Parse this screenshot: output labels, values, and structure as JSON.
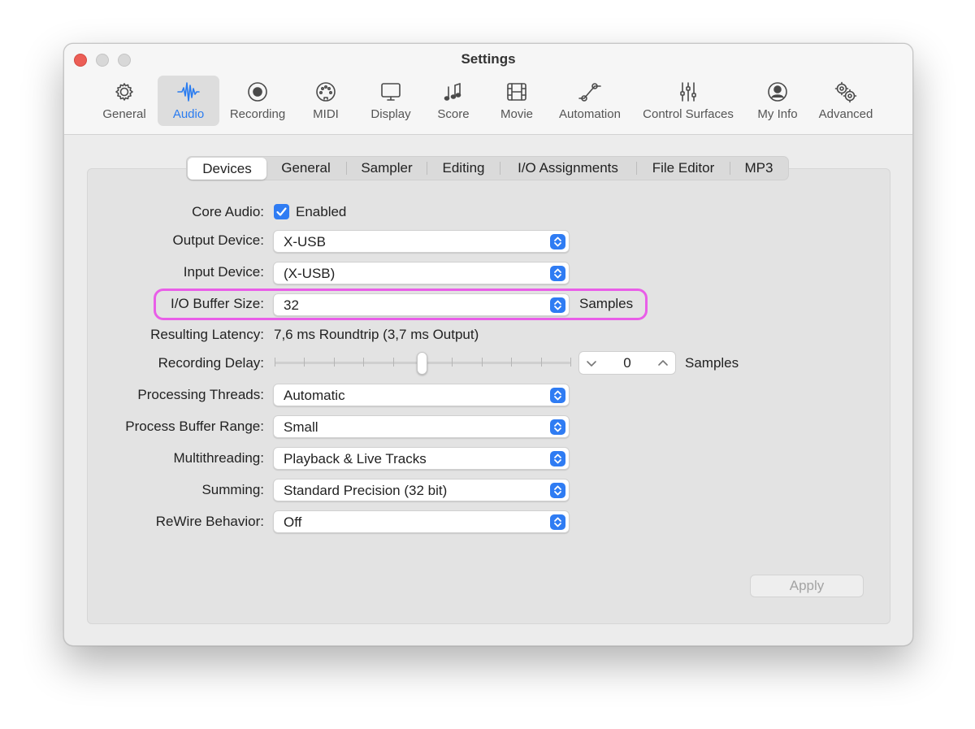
{
  "window": {
    "title": "Settings"
  },
  "toolbar": {
    "items": [
      {
        "label": "General",
        "icon": "gear-icon"
      },
      {
        "label": "Audio",
        "icon": "waveform-icon",
        "selected": true
      },
      {
        "label": "Recording",
        "icon": "record-icon"
      },
      {
        "label": "MIDI",
        "icon": "midi-connector-icon"
      },
      {
        "label": "Display",
        "icon": "monitor-icon"
      },
      {
        "label": "Score",
        "icon": "music-notes-icon"
      },
      {
        "label": "Movie",
        "icon": "film-icon"
      },
      {
        "label": "Automation",
        "icon": "automation-curve-icon"
      },
      {
        "label": "Control Surfaces",
        "icon": "faders-icon"
      },
      {
        "label": "My Info",
        "icon": "person-icon"
      },
      {
        "label": "Advanced",
        "icon": "gears-icon"
      }
    ]
  },
  "tabs": [
    "Devices",
    "General",
    "Sampler",
    "Editing",
    "I/O Assignments",
    "File Editor",
    "MP3"
  ],
  "selected_tab": "Devices",
  "form": {
    "core_audio": {
      "label": "Core Audio:",
      "checkbox_label": "Enabled",
      "checked": true
    },
    "output_device": {
      "label": "Output Device:",
      "value": "X-USB"
    },
    "input_device": {
      "label": "Input Device:",
      "value": "(X-USB)"
    },
    "io_buffer": {
      "label": "I/O Buffer Size:",
      "value": "32",
      "unit": "Samples"
    },
    "latency": {
      "label": "Resulting Latency:",
      "value": "7,6 ms Roundtrip (3,7 ms Output)"
    },
    "recording_delay": {
      "label": "Recording Delay:",
      "value": "0",
      "unit": "Samples",
      "slider_fraction": 0.5
    },
    "processing_threads": {
      "label": "Processing Threads:",
      "value": "Automatic"
    },
    "process_buffer_range": {
      "label": "Process Buffer Range:",
      "value": "Small"
    },
    "multithreading": {
      "label": "Multithreading:",
      "value": "Playback & Live Tracks"
    },
    "summing": {
      "label": "Summing:",
      "value": "Standard Precision (32 bit)"
    },
    "rewire": {
      "label": "ReWire Behavior:",
      "value": "Off"
    }
  },
  "apply_label": "Apply",
  "colors": {
    "accent": "#2f7cf3",
    "highlight": "#e95ee8",
    "close": "#ec5e56"
  }
}
